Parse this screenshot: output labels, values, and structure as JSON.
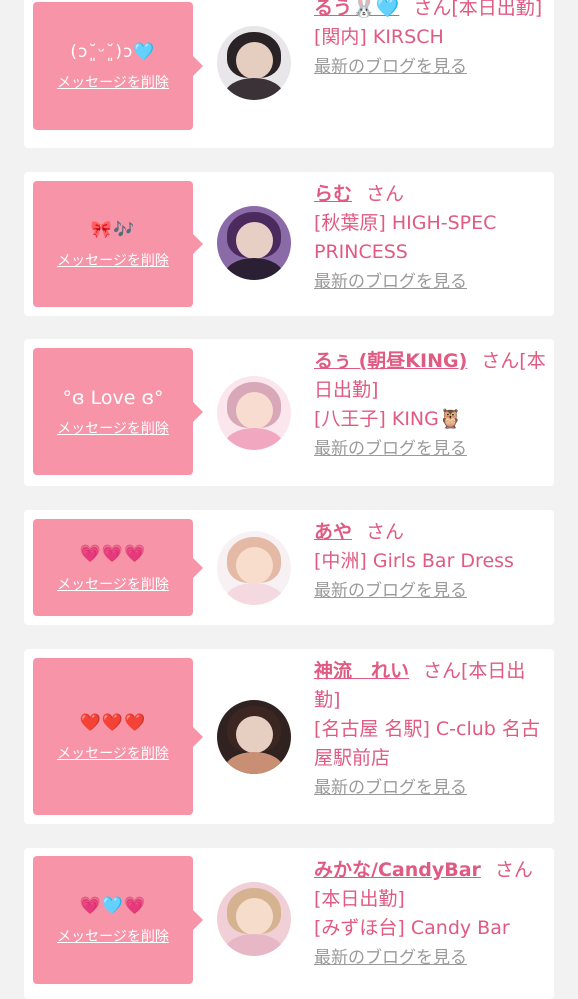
{
  "actions": {
    "delete_label": "メッセージを削除",
    "blog_label": "最新のブログを見る"
  },
  "items": [
    {
      "message": "(ɔ˘͈ᵕ˘͈)ɔ🩵",
      "name": "るう🐰🩵",
      "suffix": "さん[本日出勤]",
      "shop": "[関内] KIRSCH",
      "avatar_colors": [
        "#e9e6ea",
        "#2a2326",
        "#3a3236"
      ]
    },
    {
      "message": "🎀🎶",
      "name": "らむ",
      "suffix": "さん",
      "shop": "[秋葉原] HIGH-SPEC PRINCESS",
      "avatar_colors": [
        "#8b6aa8",
        "#4b2a5e",
        "#2a1f33"
      ]
    },
    {
      "message": "°ɞ Love ɞ°",
      "name": "るぅ (朝昼KING)",
      "suffix": "さん[本日出勤]",
      "shop": "[八王子] KING🦉",
      "avatar_colors": [
        "#fbe6ee",
        "#d9a8b8",
        "#f2a7c0"
      ]
    },
    {
      "message": "💗💗💗",
      "name": "あや",
      "suffix": "さん",
      "shop": "[中洲] Girls Bar Dress",
      "avatar_colors": [
        "#f7f1f3",
        "#e4b9a5",
        "#f4d9e0"
      ]
    },
    {
      "message": "❤️❤️❤️",
      "name": "神流　れい",
      "suffix": "さん[本日出勤]",
      "shop": "[名古屋 名駅] C-club 名古屋駅前店",
      "avatar_colors": [
        "#2f2220",
        "#3b2622",
        "#c98f75"
      ]
    },
    {
      "message": "💗🩵💗",
      "name": "みかな/CandyBar",
      "suffix": "さん[本日出勤]",
      "shop": "[みずほ台] Candy Bar",
      "avatar_colors": [
        "#f0cfd6",
        "#d6b390",
        "#e7b7c6"
      ]
    }
  ]
}
